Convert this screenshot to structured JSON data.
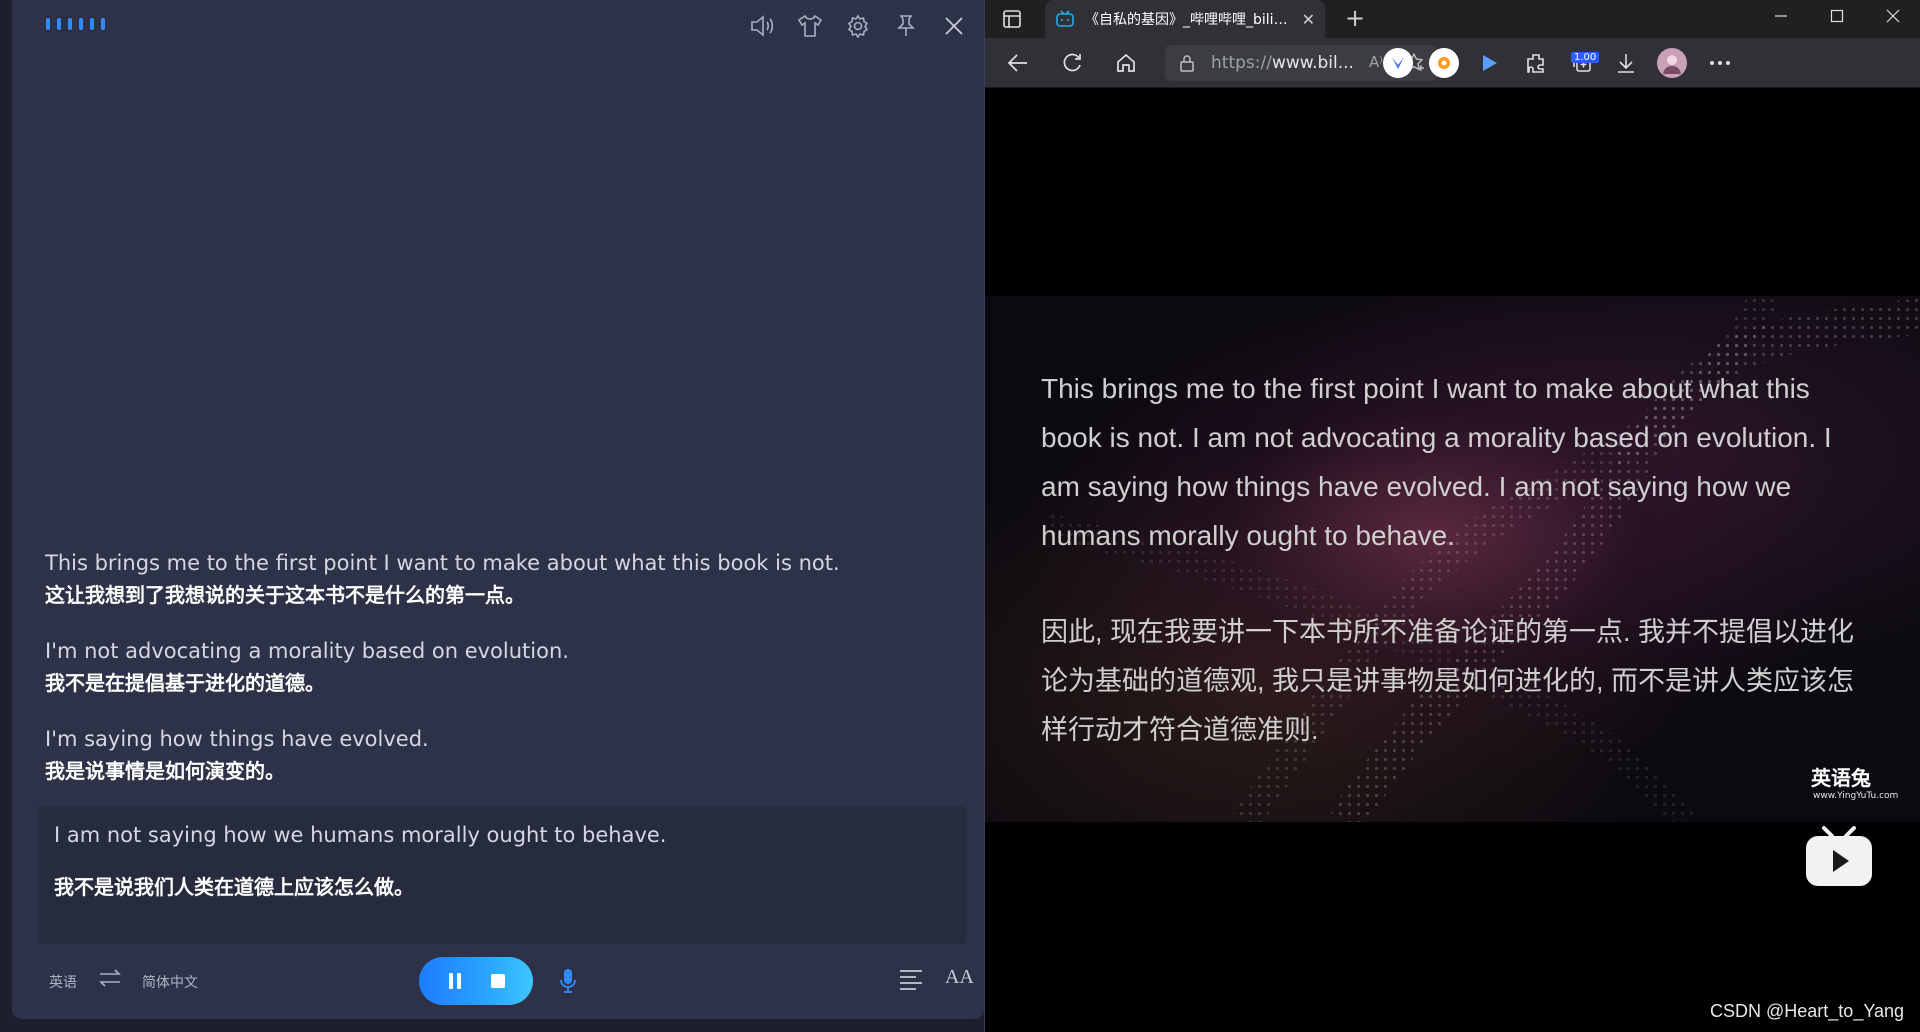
{
  "translator": {
    "entries": [
      {
        "en": "This brings me to the first point I want to make about what this book is not.",
        "zh": "这让我想到了我想说的关于这本书不是什么的第一点。"
      },
      {
        "en": "I'm not advocating a morality based on evolution.",
        "zh": "我不是在提倡基于进化的道德。"
      },
      {
        "en": "I'm saying how things have evolved.",
        "zh": "我是说事情是如何演变的。"
      }
    ],
    "current": {
      "en": "I am not saying how we humans morally ought to behave.",
      "zh": "我不是说我们人类在道德上应该怎么做。"
    },
    "source_lang": "英语",
    "target_lang": "简体中文",
    "font_button": "AA",
    "top_icons": [
      "speaker-icon",
      "shirt-icon",
      "gear-icon",
      "pin-icon",
      "close-icon"
    ],
    "accent_color": "#2f8cff"
  },
  "browser": {
    "tab_title": "《自私的基因》_哔哩哔哩_bilibili",
    "url_scheme": "https://",
    "url_host": "www.bil...",
    "read_aloud": "A⁾",
    "speed_badge": "1.00",
    "video": {
      "subtitle_en": "This brings me to the first point I want to make about what this book is not. I am not advocating a morality based on evolution. I am saying how things have evolved. I am not saying how we humans morally ought to behave.",
      "subtitle_zh": "因此, 现在我要讲一下本书所不准备论证的第一点. 我并不提倡以进化论为基础的道德观, 我只是讲事物是如何进化的, 而不是讲人类应该怎样行动才符合道德准则.",
      "watermark_name": "英语兔",
      "watermark_url": "www.YingYuTu.com"
    },
    "footer_credit": "CSDN @Heart_to_Yang"
  }
}
